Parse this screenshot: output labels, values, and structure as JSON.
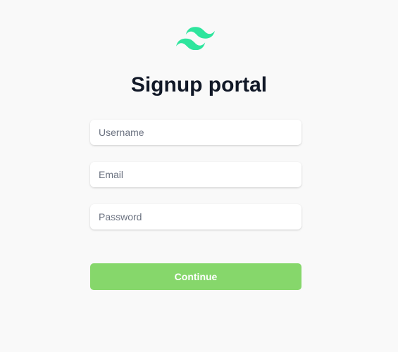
{
  "brand": {
    "logo_icon": "tailwind-waves-icon",
    "logo_color": "#2ee59d"
  },
  "page": {
    "title": "Signup portal"
  },
  "form": {
    "username": {
      "value": "",
      "placeholder": "Username"
    },
    "email": {
      "value": "",
      "placeholder": "Email"
    },
    "password": {
      "value": "",
      "placeholder": "Password"
    },
    "continue_label": "Continue",
    "continue_color": "#86d76b"
  },
  "colors": {
    "background": "#f9f9f9",
    "title": "#111827",
    "placeholder": "#6b7280"
  }
}
